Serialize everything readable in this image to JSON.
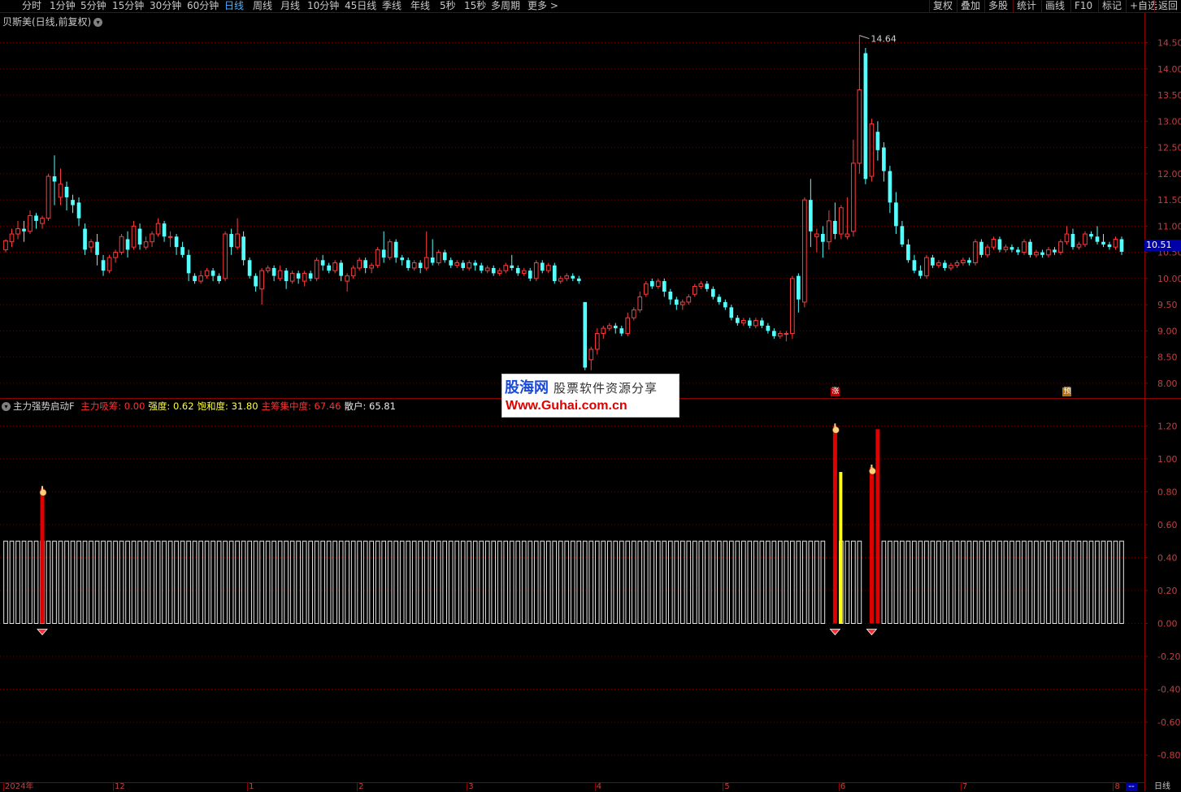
{
  "toolbar": {
    "periods": [
      "分时",
      "1分钟",
      "5分钟",
      "15分钟",
      "30分钟",
      "60分钟",
      "日线",
      "周线",
      "月线",
      "10分钟",
      "45日线",
      "季线",
      "年线",
      "5秒",
      "15秒",
      "多周期",
      "更多 >"
    ],
    "active": "日线",
    "right_buttons": [
      "复权",
      "叠加",
      "多股",
      "统计",
      "画线",
      "F10",
      "标记",
      "+自选",
      "返回"
    ]
  },
  "main_chart": {
    "title": "贝斯美(日线,前复权)",
    "high_label": "14.64",
    "current_price": "10.51",
    "y_ticks": [
      "14.50",
      "14.00",
      "13.50",
      "13.00",
      "12.50",
      "12.00",
      "11.50",
      "11.00",
      "10.50",
      "10.00",
      "9.50",
      "9.00",
      "8.50",
      "8.00"
    ],
    "y_range": [
      7.75,
      14.85
    ],
    "candles": [
      [
        10.55,
        10.72,
        10.5,
        10.75
      ],
      [
        10.7,
        10.85,
        10.6,
        10.95
      ],
      [
        10.85,
        10.95,
        10.75,
        11.1
      ],
      [
        10.95,
        10.9,
        10.7,
        11.1
      ],
      [
        10.9,
        11.2,
        10.85,
        11.3
      ],
      [
        11.2,
        11.1,
        10.95,
        11.25
      ],
      [
        11.05,
        11.15,
        10.95,
        11.2
      ],
      [
        11.15,
        11.95,
        11.1,
        12.0
      ],
      [
        11.95,
        11.85,
        11.4,
        12.35
      ],
      [
        11.55,
        11.8,
        11.4,
        12.1
      ],
      [
        11.75,
        11.55,
        11.3,
        11.85
      ],
      [
        11.5,
        11.4,
        11.25,
        11.6
      ],
      [
        11.45,
        11.15,
        11.0,
        11.55
      ],
      [
        10.95,
        10.55,
        10.45,
        11.05
      ],
      [
        10.6,
        10.7,
        10.5,
        10.75
      ],
      [
        10.7,
        10.45,
        10.25,
        10.85
      ],
      [
        10.35,
        10.15,
        10.05,
        10.45
      ],
      [
        10.15,
        10.4,
        10.1,
        10.45
      ],
      [
        10.4,
        10.5,
        10.3,
        10.55
      ],
      [
        10.5,
        10.8,
        10.45,
        10.85
      ],
      [
        10.75,
        10.55,
        10.4,
        10.9
      ],
      [
        10.6,
        11.0,
        10.55,
        11.1
      ],
      [
        10.95,
        10.65,
        10.55,
        11.05
      ],
      [
        10.6,
        10.7,
        10.55,
        10.8
      ],
      [
        10.7,
        10.85,
        10.6,
        10.9
      ],
      [
        10.85,
        11.05,
        10.8,
        11.15
      ],
      [
        11.05,
        10.8,
        10.7,
        11.1
      ],
      [
        10.8,
        10.8,
        10.6,
        10.9
      ],
      [
        10.8,
        10.6,
        10.45,
        10.85
      ],
      [
        10.6,
        10.45,
        10.4,
        10.7
      ],
      [
        10.45,
        10.1,
        9.95,
        10.55
      ],
      [
        10.05,
        9.95,
        9.9,
        10.1
      ],
      [
        9.95,
        10.05,
        9.9,
        10.15
      ],
      [
        10.05,
        10.15,
        10.0,
        10.2
      ],
      [
        10.15,
        10.05,
        9.95,
        10.2
      ],
      [
        10.05,
        9.95,
        9.9,
        10.1
      ],
      [
        10.0,
        10.85,
        9.95,
        10.9
      ],
      [
        10.85,
        10.6,
        10.45,
        10.95
      ],
      [
        10.6,
        10.85,
        10.55,
        11.15
      ],
      [
        10.8,
        10.35,
        10.25,
        10.9
      ],
      [
        10.35,
        10.05,
        10.0,
        10.4
      ],
      [
        10.05,
        9.85,
        9.75,
        10.1
      ],
      [
        9.8,
        10.15,
        9.5,
        10.2
      ],
      [
        10.15,
        10.2,
        10.1,
        10.25
      ],
      [
        10.2,
        10.05,
        9.95,
        10.25
      ],
      [
        10.0,
        10.15,
        9.95,
        10.25
      ],
      [
        10.15,
        9.95,
        9.8,
        10.2
      ],
      [
        9.95,
        10.1,
        9.9,
        10.15
      ],
      [
        10.1,
        10.0,
        9.9,
        10.15
      ],
      [
        9.95,
        10.1,
        9.85,
        10.15
      ],
      [
        10.1,
        10.0,
        9.95,
        10.15
      ],
      [
        10.0,
        10.35,
        9.95,
        10.4
      ],
      [
        10.35,
        10.25,
        10.15,
        10.45
      ],
      [
        10.25,
        10.15,
        10.1,
        10.3
      ],
      [
        10.15,
        10.3,
        10.1,
        10.35
      ],
      [
        10.3,
        10.05,
        9.95,
        10.35
      ],
      [
        9.95,
        10.05,
        9.75,
        10.1
      ],
      [
        10.05,
        10.2,
        10.0,
        10.25
      ],
      [
        10.2,
        10.35,
        10.15,
        10.4
      ],
      [
        10.35,
        10.2,
        10.1,
        10.4
      ],
      [
        10.2,
        10.25,
        10.1,
        10.3
      ],
      [
        10.25,
        10.55,
        10.2,
        10.6
      ],
      [
        10.55,
        10.4,
        10.3,
        10.9
      ],
      [
        10.4,
        10.7,
        10.35,
        10.75
      ],
      [
        10.7,
        10.4,
        10.3,
        10.75
      ],
      [
        10.4,
        10.35,
        10.25,
        10.45
      ],
      [
        10.35,
        10.2,
        10.15,
        10.4
      ],
      [
        10.2,
        10.3,
        10.15,
        10.35
      ],
      [
        10.3,
        10.2,
        10.1,
        10.35
      ],
      [
        10.2,
        10.4,
        10.15,
        10.9
      ],
      [
        10.4,
        10.3,
        10.25,
        10.75
      ],
      [
        10.3,
        10.5,
        10.25,
        10.55
      ],
      [
        10.5,
        10.35,
        10.3,
        10.55
      ],
      [
        10.35,
        10.25,
        10.2,
        10.4
      ],
      [
        10.25,
        10.3,
        10.2,
        10.35
      ],
      [
        10.3,
        10.2,
        10.15,
        10.35
      ],
      [
        10.2,
        10.3,
        10.15,
        10.35
      ],
      [
        10.3,
        10.25,
        10.15,
        10.35
      ],
      [
        10.25,
        10.15,
        10.1,
        10.3
      ],
      [
        10.15,
        10.2,
        10.1,
        10.25
      ],
      [
        10.2,
        10.1,
        10.05,
        10.25
      ],
      [
        10.1,
        10.15,
        10.05,
        10.2
      ],
      [
        10.15,
        10.25,
        10.1,
        10.3
      ],
      [
        10.25,
        10.2,
        10.15,
        10.45
      ],
      [
        10.2,
        10.1,
        10.05,
        10.25
      ],
      [
        10.1,
        10.15,
        10.05,
        10.2
      ],
      [
        10.15,
        10.0,
        9.95,
        10.2
      ],
      [
        10.0,
        10.3,
        9.95,
        10.35
      ],
      [
        10.3,
        10.15,
        10.1,
        10.35
      ],
      [
        10.15,
        10.25,
        10.1,
        10.3
      ],
      [
        10.25,
        9.95,
        9.9,
        10.3
      ],
      [
        9.95,
        10.0,
        9.9,
        10.05
      ],
      [
        10.0,
        10.05,
        9.95,
        10.1
      ],
      [
        10.05,
        10.0,
        9.95,
        10.1
      ],
      [
        10.0,
        9.95,
        9.9,
        10.05
      ],
      [
        9.55,
        8.3,
        8.25,
        9.55
      ],
      [
        8.45,
        8.65,
        8.25,
        8.7
      ],
      [
        8.65,
        8.95,
        8.55,
        9.05
      ],
      [
        8.95,
        9.05,
        8.85,
        9.1
      ],
      [
        9.05,
        9.1,
        9.0,
        9.15
      ],
      [
        9.1,
        9.05,
        8.95,
        9.15
      ],
      [
        9.05,
        8.95,
        8.9,
        9.1
      ],
      [
        8.95,
        9.25,
        8.9,
        9.35
      ],
      [
        9.25,
        9.4,
        9.2,
        9.45
      ],
      [
        9.4,
        9.65,
        9.35,
        9.75
      ],
      [
        9.7,
        9.9,
        9.65,
        9.95
      ],
      [
        9.95,
        9.85,
        9.8,
        10.0
      ],
      [
        9.85,
        9.95,
        9.8,
        10.0
      ],
      [
        9.95,
        9.75,
        9.65,
        10.0
      ],
      [
        9.75,
        9.6,
        9.5,
        9.8
      ],
      [
        9.6,
        9.5,
        9.4,
        9.65
      ],
      [
        9.5,
        9.55,
        9.4,
        9.6
      ],
      [
        9.55,
        9.65,
        9.5,
        9.7
      ],
      [
        9.7,
        9.85,
        9.65,
        9.9
      ],
      [
        9.85,
        9.9,
        9.8,
        9.95
      ],
      [
        9.9,
        9.8,
        9.75,
        9.95
      ],
      [
        9.8,
        9.65,
        9.6,
        9.85
      ],
      [
        9.65,
        9.55,
        9.5,
        9.7
      ],
      [
        9.55,
        9.45,
        9.4,
        9.6
      ],
      [
        9.45,
        9.25,
        9.2,
        9.5
      ],
      [
        9.25,
        9.15,
        9.1,
        9.3
      ],
      [
        9.15,
        9.2,
        9.1,
        9.25
      ],
      [
        9.2,
        9.1,
        9.05,
        9.25
      ],
      [
        9.1,
        9.2,
        9.05,
        9.25
      ],
      [
        9.2,
        9.1,
        9.05,
        9.25
      ],
      [
        9.1,
        9.0,
        8.95,
        9.15
      ],
      [
        9.0,
        8.9,
        8.85,
        9.05
      ],
      [
        8.9,
        8.95,
        8.85,
        9.0
      ],
      [
        8.95,
        8.95,
        8.8,
        9.0
      ],
      [
        8.95,
        10.0,
        8.85,
        10.05
      ],
      [
        10.05,
        9.6,
        9.35,
        10.1
      ],
      [
        9.55,
        11.5,
        9.45,
        11.55
      ],
      [
        11.5,
        10.9,
        10.6,
        11.9
      ],
      [
        10.8,
        10.85,
        10.5,
        10.95
      ],
      [
        10.85,
        10.7,
        10.4,
        11.0
      ],
      [
        10.7,
        11.1,
        10.55,
        11.3
      ],
      [
        11.1,
        10.85,
        10.75,
        11.45
      ],
      [
        10.85,
        11.35,
        10.75,
        11.4
      ],
      [
        10.8,
        10.85,
        10.75,
        11.55
      ],
      [
        10.9,
        12.2,
        10.8,
        12.65
      ],
      [
        12.2,
        13.6,
        12.0,
        14.64
      ],
      [
        14.3,
        11.9,
        11.8,
        14.4
      ],
      [
        11.95,
        12.95,
        11.85,
        13.05
      ],
      [
        12.8,
        12.45,
        12.25,
        13.0
      ],
      [
        12.5,
        12.05,
        11.85,
        12.6
      ],
      [
        12.05,
        11.45,
        11.25,
        12.15
      ],
      [
        11.45,
        11.0,
        10.85,
        11.65
      ],
      [
        11.0,
        10.65,
        10.6,
        11.1
      ],
      [
        10.65,
        10.35,
        10.3,
        10.75
      ],
      [
        10.35,
        10.15,
        10.1,
        10.45
      ],
      [
        10.15,
        10.05,
        10.0,
        10.25
      ],
      [
        10.05,
        10.4,
        10.0,
        10.45
      ],
      [
        10.4,
        10.25,
        10.2,
        10.45
      ],
      [
        10.25,
        10.3,
        10.2,
        10.35
      ],
      [
        10.3,
        10.2,
        10.15,
        10.35
      ],
      [
        10.2,
        10.25,
        10.15,
        10.3
      ],
      [
        10.25,
        10.3,
        10.2,
        10.35
      ],
      [
        10.3,
        10.35,
        10.25,
        10.4
      ],
      [
        10.35,
        10.3,
        10.25,
        10.4
      ],
      [
        10.3,
        10.7,
        10.25,
        10.75
      ],
      [
        10.7,
        10.45,
        10.4,
        10.75
      ],
      [
        10.45,
        10.6,
        10.4,
        10.65
      ],
      [
        10.6,
        10.75,
        10.55,
        10.8
      ],
      [
        10.75,
        10.55,
        10.5,
        10.8
      ],
      [
        10.55,
        10.6,
        10.5,
        10.65
      ],
      [
        10.6,
        10.55,
        10.5,
        10.65
      ],
      [
        10.55,
        10.5,
        10.45,
        10.6
      ],
      [
        10.5,
        10.7,
        10.45,
        10.75
      ],
      [
        10.7,
        10.45,
        10.4,
        10.75
      ],
      [
        10.45,
        10.5,
        10.4,
        10.55
      ],
      [
        10.5,
        10.45,
        10.4,
        10.55
      ],
      [
        10.45,
        10.55,
        10.4,
        10.6
      ],
      [
        10.55,
        10.5,
        10.45,
        10.6
      ],
      [
        10.5,
        10.7,
        10.45,
        10.75
      ],
      [
        10.7,
        10.85,
        10.65,
        11.0
      ],
      [
        10.85,
        10.6,
        10.55,
        10.95
      ],
      [
        10.6,
        10.65,
        10.55,
        10.7
      ],
      [
        10.65,
        10.85,
        10.6,
        10.9
      ],
      [
        10.85,
        10.8,
        10.75,
        10.9
      ],
      [
        10.8,
        10.7,
        10.65,
        11.0
      ],
      [
        10.7,
        10.65,
        10.6,
        10.85
      ],
      [
        10.65,
        10.6,
        10.55,
        10.7
      ],
      [
        10.6,
        10.75,
        10.55,
        10.8
      ],
      [
        10.75,
        10.51,
        10.45,
        10.8
      ]
    ],
    "badges": [
      {
        "label": "涨",
        "color": "#c00000",
        "index": 136
      },
      {
        "label": "预",
        "color": "#b87000",
        "index": 174
      }
    ]
  },
  "indicator": {
    "name": "主力强势启动F",
    "fields": [
      {
        "label": "主力吸筹: 0.00",
        "color": "#ff3030"
      },
      {
        "label": "强度: 0.62",
        "color": "#ffff40"
      },
      {
        "label": "饱和度: 31.80",
        "color": "#ffff40"
      },
      {
        "label": "主筹集中度: 67.46",
        "color": "#ff3030"
      },
      {
        "label": "散户: 65.81",
        "color": "#e8e8e8"
      }
    ],
    "y_ticks": [
      "1.20",
      "1.00",
      "0.80",
      "0.60",
      "0.40",
      "0.20",
      "0.00",
      "-0.20",
      "-0.40",
      "-0.60",
      "-0.80"
    ],
    "y_range": [
      -0.95,
      1.32
    ],
    "base_value": 0.5,
    "signals": [
      {
        "index": 6,
        "red": 0.82,
        "yellow": 0,
        "icon": 0.82
      },
      {
        "index": 136,
        "red": 1.2,
        "yellow": 0.92,
        "icon": 1.2
      },
      {
        "index": 142,
        "red": 0.95,
        "yellow": 0,
        "icon": 0.95
      },
      {
        "index": 143,
        "red": 1.18,
        "yellow": 0,
        "icon": 0
      }
    ],
    "gaps": [
      135,
      136,
      141,
      142,
      143
    ]
  },
  "date_axis": {
    "labels": [
      {
        "text": "2024年",
        "index": 0
      },
      {
        "text": "12",
        "index": 18
      },
      {
        "text": "1",
        "index": 40
      },
      {
        "text": "2",
        "index": 58
      },
      {
        "text": "3",
        "index": 76
      },
      {
        "text": "4",
        "index": 97
      },
      {
        "text": "5",
        "index": 118
      },
      {
        "text": "6",
        "index": 137
      },
      {
        "text": "7",
        "index": 157
      },
      {
        "text": "8",
        "index": 182
      }
    ],
    "right_cells": [
      "--",
      "日线"
    ]
  },
  "watermark": {
    "brand": "股海网",
    "slogan": "股票软件资源分享",
    "url": "Www.Guhai.com.cn"
  },
  "colors": {
    "up": "#ff3c3c",
    "down": "#54ffff",
    "grid": "#6a0000",
    "axis_text": "#c04040",
    "active_tab": "#4fb0ff"
  }
}
